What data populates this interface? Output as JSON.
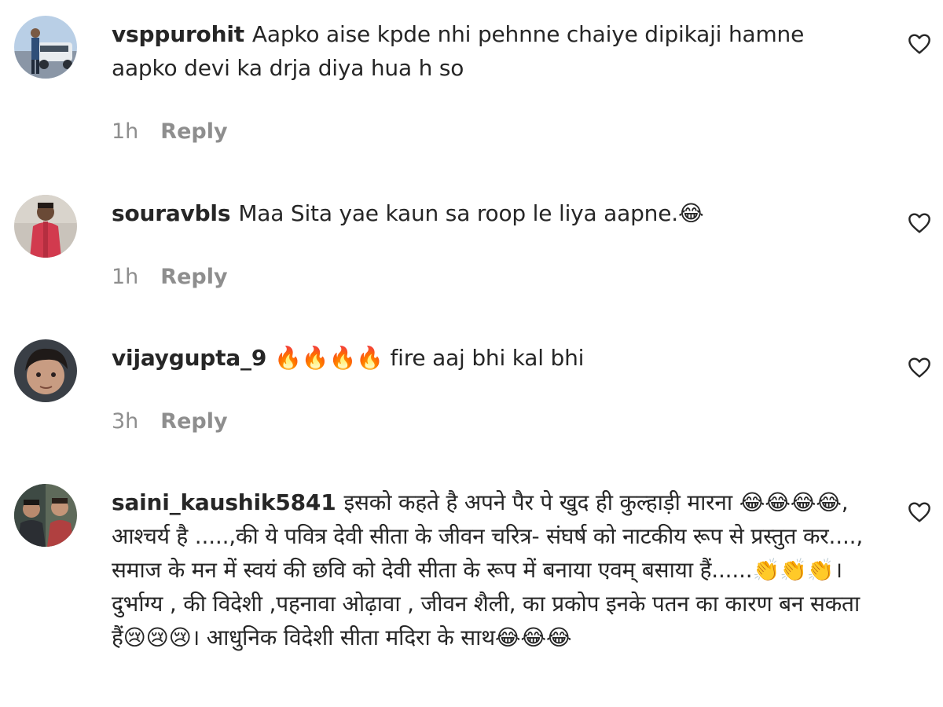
{
  "comments": [
    {
      "username": "vsppurohit",
      "text": "Aapko aise kpde nhi pehnne chaiye dipikaji hamne aapko devi ka drja diya hua h so",
      "time": "1h",
      "reply_label": "Reply"
    },
    {
      "username": "souravbls",
      "text": "Maa Sita yae kaun sa roop le liya aapne.😂",
      "time": "1h",
      "reply_label": "Reply"
    },
    {
      "username": "vijaygupta_9",
      "text": "🔥🔥🔥🔥 fire aaj bhi kal bhi",
      "time": "3h",
      "reply_label": "Reply"
    },
    {
      "username": "saini_kaushik5841",
      "text": "इसको कहते है अपने पैर पे खुद ही कुल्हाड़ी मारना 😂😂😂😂, आश्चर्य है .....,की ये पवित्र देवी सीता के जीवन चरित्र- संघर्ष को नाटकीय रूप से प्रस्तुत कर...., समाज के मन में स्वयं की छवि को देवी सीता के रूप में बनाया एवम् बसाया हैं......👏👏👏। दुर्भाग्य , की विदेशी ,पहनावा ओढ़ावा , जीवन शैली, का प्रकोप इनके पतन का कारण बन सकता हैं😢😢😢। आधुनिक विदेशी सीता मदिरा के साथ😂😂😂"
    }
  ],
  "icons": {
    "like": "heart-outline-icon"
  },
  "colors": {
    "text": "#262626",
    "meta": "#8e8e8e"
  }
}
